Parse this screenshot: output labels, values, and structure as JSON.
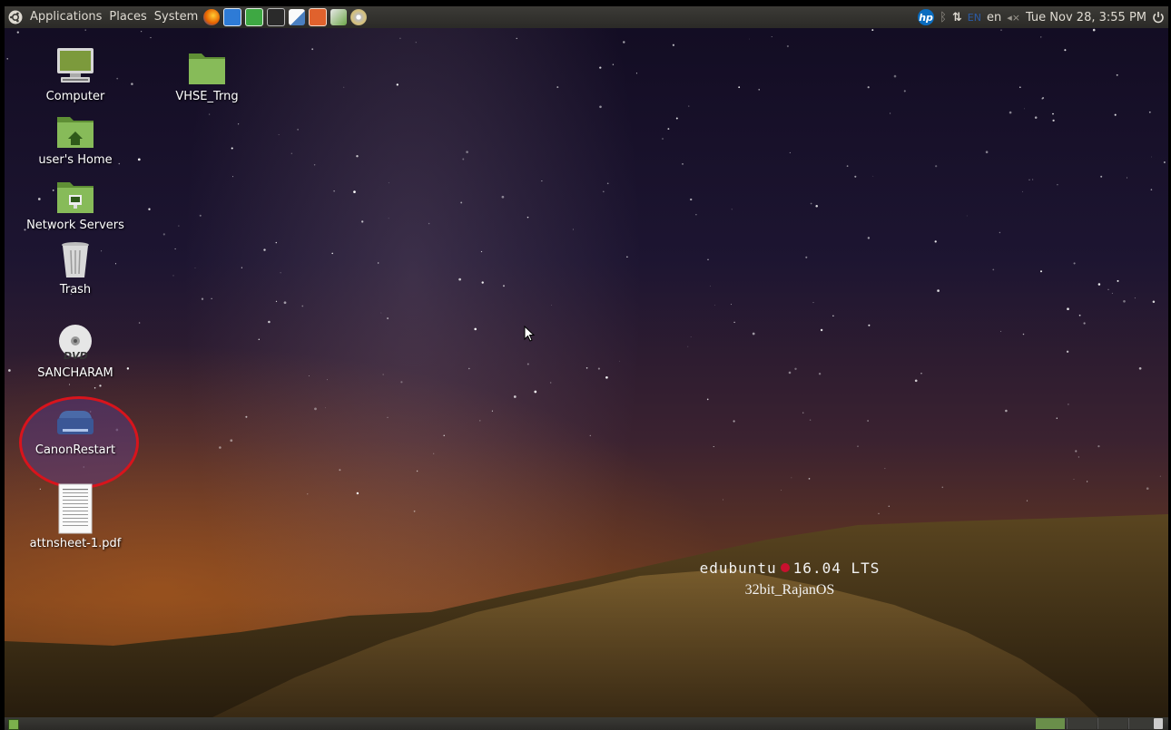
{
  "top_panel": {
    "menus": [
      "Applications",
      "Places",
      "System"
    ],
    "launchers": [
      "firefox-icon",
      "writer-icon",
      "calc-icon",
      "terminal-icon",
      "text-editor-icon",
      "impress-icon",
      "tools-icon",
      "brasero-icon"
    ],
    "tray": {
      "language_badge": "EN",
      "keyboard_layout": "en",
      "volume": "◂×",
      "clock": "Tue Nov 28,  3:55 PM"
    }
  },
  "desktop": {
    "icons": [
      {
        "label": "Computer",
        "icon": "computer-icon"
      },
      {
        "label": "VHSE_Trng",
        "icon": "folder-icon"
      },
      {
        "label": "user's Home",
        "icon": "home-folder-icon"
      },
      {
        "label": "Network Servers",
        "icon": "network-folder-icon"
      },
      {
        "label": "Trash",
        "icon": "trash-icon"
      },
      {
        "label": "SANCHARAM",
        "icon": "dvd-icon",
        "badge": "DVD"
      },
      {
        "label": "CanonRestart",
        "icon": "printer-icon"
      },
      {
        "label": "attnsheet-1.pdf",
        "icon": "pdf-document-icon"
      }
    ],
    "watermark": {
      "line1_left": "edubuntu",
      "line1_right": "16.04 LTS",
      "line2": "32bit_RajanOS"
    }
  },
  "colors": {
    "panel": "#2b2a27",
    "highlight_ring": "#d8141c",
    "folder_green": "#7bb04c"
  }
}
